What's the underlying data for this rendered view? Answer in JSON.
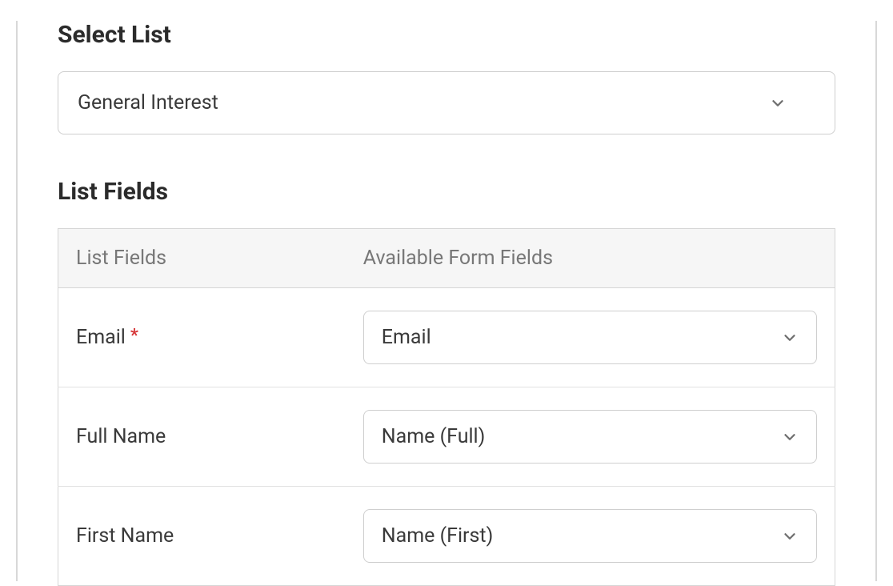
{
  "sections": {
    "select_list": {
      "heading": "Select List",
      "value": "General Interest"
    },
    "list_fields": {
      "heading": "List Fields",
      "columns": {
        "col1": "List Fields",
        "col2": "Available Form Fields"
      },
      "rows": [
        {
          "label": "Email",
          "required": true,
          "required_marker": "*",
          "value": "Email"
        },
        {
          "label": "Full Name",
          "required": false,
          "value": "Name (Full)"
        },
        {
          "label": "First Name",
          "required": false,
          "value": "Name (First)"
        }
      ]
    }
  }
}
